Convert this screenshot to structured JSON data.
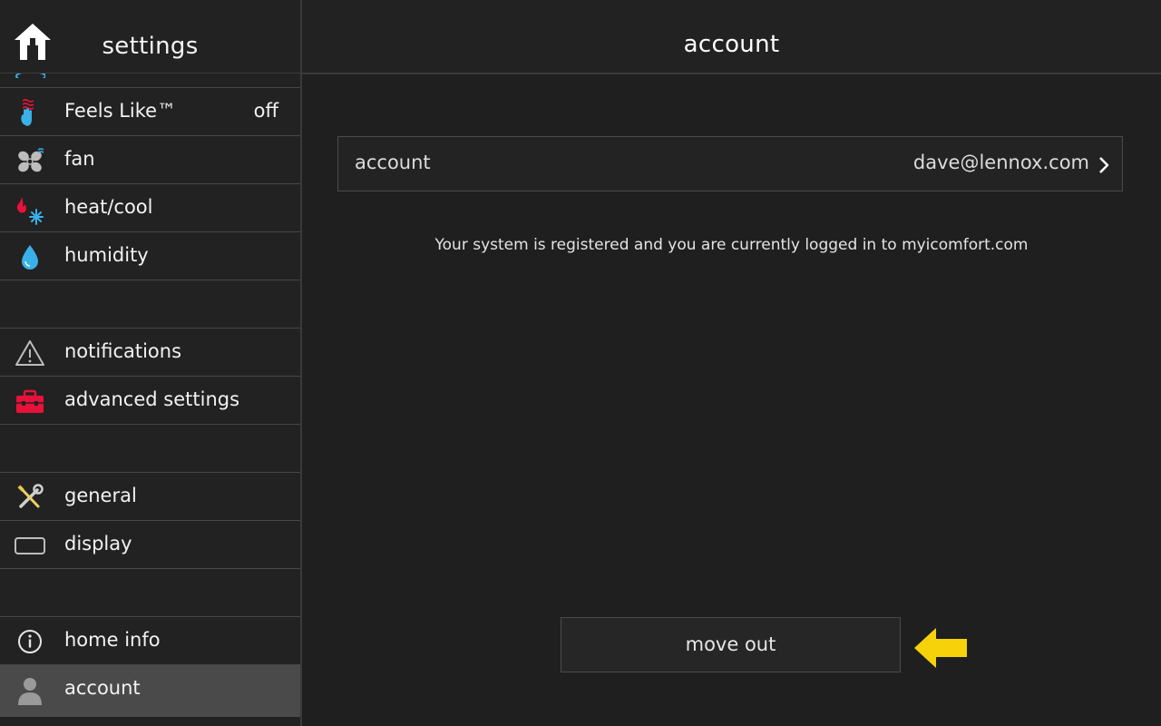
{
  "sidebar": {
    "title": "settings",
    "items": [
      {
        "label": "",
        "icon": "partial-icon"
      },
      {
        "label": "Feels Like™",
        "value": "off",
        "icon": "feels-like-icon"
      },
      {
        "label": "fan",
        "icon": "fan-icon"
      },
      {
        "label": "heat/cool",
        "icon": "heat-cool-icon"
      },
      {
        "label": "humidity",
        "icon": "humidity-icon"
      },
      {
        "label": "notifications",
        "icon": "warning-icon"
      },
      {
        "label": "advanced settings",
        "icon": "toolbox-icon"
      },
      {
        "label": "general",
        "icon": "tools-icon"
      },
      {
        "label": "display",
        "icon": "display-icon"
      },
      {
        "label": "home info",
        "icon": "info-icon"
      },
      {
        "label": "account",
        "icon": "user-icon",
        "active": true
      }
    ]
  },
  "main": {
    "title": "account",
    "account_row": {
      "label": "account",
      "value": "dave@lennox.com"
    },
    "status_text": "Your system is registered and you are currently logged in to myicomfort.com",
    "move_out_label": "move out"
  },
  "colors": {
    "background": "#1f1f1f",
    "active_item": "#4a4a4a",
    "arrow": "#f5d20a",
    "heat_red": "#e8113a",
    "cool_blue": "#3ab0e8"
  }
}
